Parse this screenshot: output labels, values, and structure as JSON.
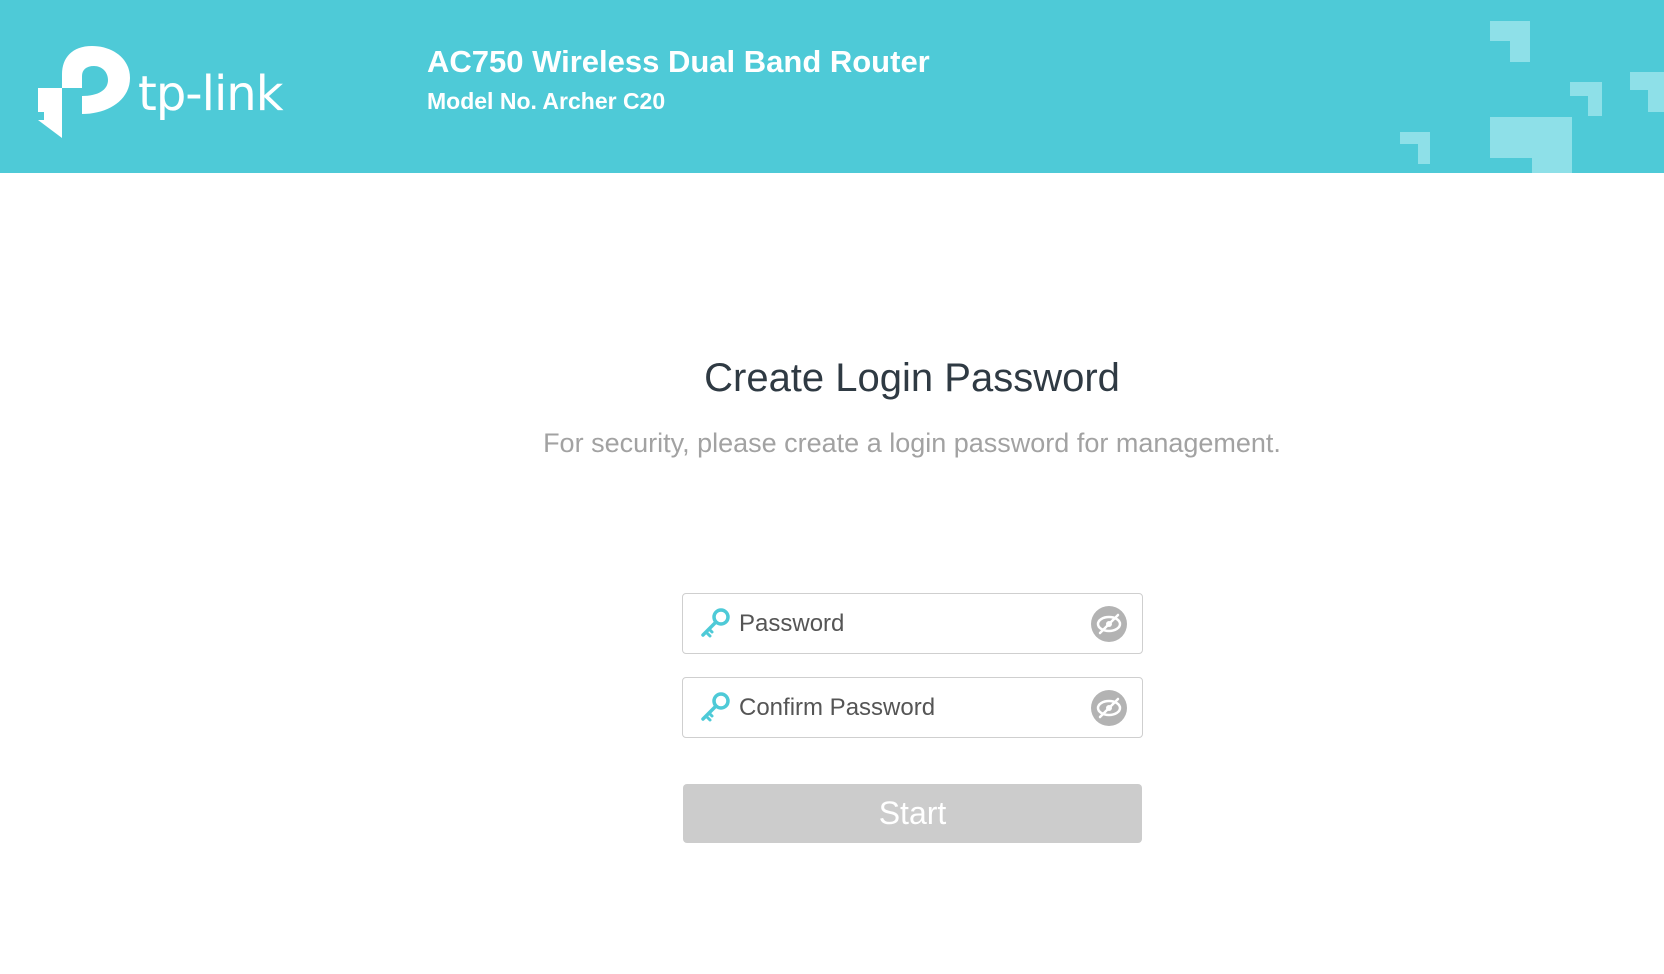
{
  "header": {
    "logo_text": "tp-link",
    "product_name": "AC750 Wireless Dual Band Router",
    "model_no": "Model No. Archer C20",
    "background_color": "#4ecad7"
  },
  "main": {
    "title": "Create Login Password",
    "subtitle": "For security, please create a login password for management.",
    "password_field": {
      "value": "",
      "placeholder": "Password",
      "icon": "key-icon",
      "toggle_icon": "eye-slash-icon"
    },
    "confirm_field": {
      "value": "",
      "placeholder": "Confirm Password",
      "icon": "key-icon",
      "toggle_icon": "eye-slash-icon"
    },
    "start_label": "Start",
    "accent_color": "#4ecad7",
    "button_color": "#cccccc"
  }
}
